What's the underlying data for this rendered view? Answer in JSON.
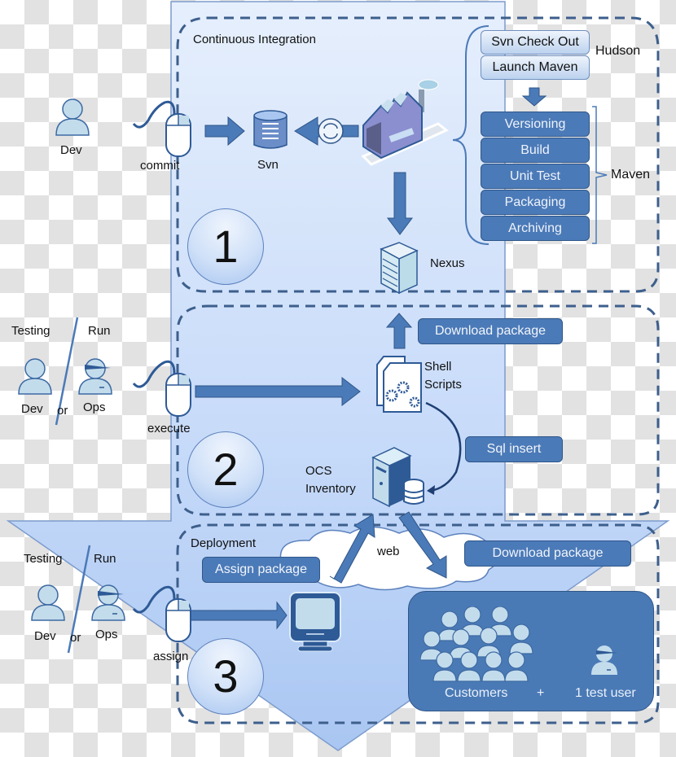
{
  "diagram": {
    "colors": {
      "arrow_fill": "#c7dbfb",
      "arrow_stroke": "#7d9ccc",
      "dash_stroke": "#3d5f8c",
      "box_dark": "#4b7ab8",
      "icon_light": "#c3dcec",
      "icon_dark": "#2e5a96"
    },
    "stage1": {
      "number": "1",
      "title": "Continuous Integration",
      "actor": "Dev",
      "action": "commit",
      "repo": "Svn",
      "artifact_repo": "Nexus",
      "hudson": {
        "label": "Hudson",
        "steps": [
          "Svn Check Out",
          "Launch Maven"
        ]
      },
      "maven": {
        "label": "Maven",
        "steps": [
          "Versioning",
          "Build",
          "Unit Test",
          "Packaging",
          "Archiving"
        ]
      }
    },
    "stage2": {
      "number": "2",
      "role_left": "Testing",
      "role_right": "Run",
      "actor_left": "Dev",
      "connector": "or",
      "actor_right": "Ops",
      "action": "execute",
      "scripts_label": [
        "Shell",
        "Scripts"
      ],
      "download_label": "Download package",
      "sql_label": "Sql insert",
      "inventory_label": [
        "OCS",
        "Inventory"
      ]
    },
    "stage3": {
      "number": "3",
      "title": "Deployment",
      "role_left": "Testing",
      "role_right": "Run",
      "actor_left": "Dev",
      "connector": "or",
      "actor_right": "Ops",
      "action": "assign",
      "assign_label": "Assign package",
      "cloud_label": "web",
      "download_label": "Download package",
      "customers_label": "Customers",
      "plus": "+",
      "test_user_label": "1 test user"
    }
  }
}
